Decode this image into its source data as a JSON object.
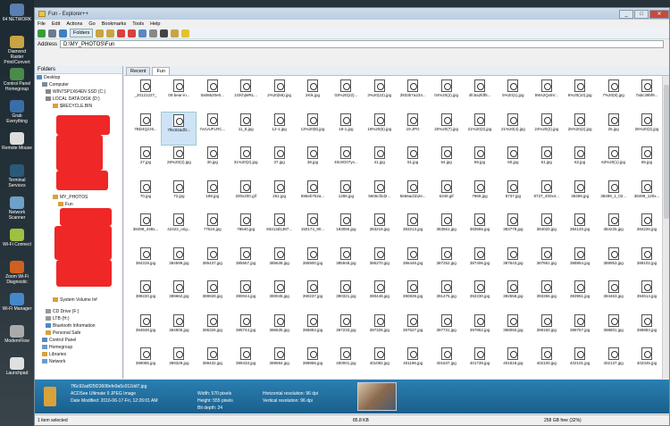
{
  "window": {
    "title": "Fun - Explorer++"
  },
  "menu": [
    "File",
    "Edit",
    "Actions",
    "Go",
    "Bookmarks",
    "Tools",
    "Help"
  ],
  "toolbar": {
    "folders_label": "Folders"
  },
  "address": {
    "label": "Address",
    "value": "D:\\MY_PHOTOS\\Fun"
  },
  "tabs": [
    "Recent",
    "Fun"
  ],
  "folders_pane": {
    "title": "Folders",
    "items": [
      "Desktop",
      "Computer",
      "WIN7SP1X64EN SSD (C:)",
      "LOCAL DATA DISK (D:)",
      "$RECYCLE.BIN",
      "MY_PHOTOS",
      "Fun",
      "System Volume Inf",
      "CD Drive (F:)",
      "LTB (H:)",
      "Bluetooth Information",
      "Personal Safe",
      "Control Panel",
      "Homegroup",
      "Libraries",
      "Network"
    ]
  },
  "files": [
    "_20121227_",
    "00-bear-in...",
    "0a08620e0...",
    "1GKhjMRL...",
    "2%20(66).jpg",
    "2Kik.jpg",
    "03%20(22)...",
    "3%20(22).jpg",
    "3933b7a234...",
    "04%20(2).jpg",
    "4fc5a2fdf5...",
    "5%20(1).jpg",
    "5Wx2Qx5V...",
    "6%20(10).jpg",
    "7%20(9).jpg",
    "7abc39bf9...",
    "7BD4Qzz6...",
    "7f6c92adf2...",
    "7vcUUFLRC...",
    "11_8.jpg",
    "12-1.jpg",
    "13%20(8).jpg",
    "18-1.jpg",
    "19%20(5).jpg",
    "19.JPG",
    "20%20(7).jpg",
    "21%20(3).jpg",
    "21%20(4).jpg",
    "24%20(2).jpg",
    "25%20(2).jpg",
    "25.jpg",
    "26%20(3).jpg",
    "27.jpg",
    "28%20(2).jpg",
    "30.jpg",
    "31%20(2).jpg",
    "37.jpg",
    "38.jpg",
    "40c8G07yx...",
    "41.jpg",
    "51.jpg",
    "54.jpg",
    "59.jpg",
    "60.jpg",
    "61.jpg",
    "62.jpg",
    "63%20(1).jpg",
    "65.jpg",
    "70.jpg",
    "72.jpg",
    "189.jpg",
    "200x200.gif",
    "261.jpg",
    "695eb762a...",
    "1286.jpg",
    "5606cf2d2...",
    "5666ad1b2e...",
    "6348.gif",
    "7869.jpg",
    "8737.jpg",
    "8737_400x4...",
    "38499.jpg",
    "38499_1_02...",
    "38499_120x...",
    "38499_448x...",
    "42422_orig...",
    "77524.jpg",
    "78540.jpg",
    "93413d1387...",
    "150174_90...",
    "183050.jpg",
    "383219.jpg",
    "383213.jpg",
    "383561.jpg",
    "383655.jpg",
    "383779.jpg",
    "384020.jpg",
    "384120.jpg",
    "384225.jpg",
    "384226.jpg",
    "384319.jpg",
    "384599.jpg",
    "385437.jpg",
    "385557.jpg",
    "385638.jpg",
    "385900.jpg",
    "385948.jpg",
    "386270.jpg",
    "386446.jpg",
    "387252.jpg",
    "387406.jpg",
    "387643.jpg",
    "387861.jpg",
    "388854.jpg",
    "388953.jpg",
    "389102.jpg",
    "389220.jpg",
    "389662.jpg",
    "389928.jpg",
    "390044.jpg",
    "390045.jpg",
    "390237.jpg",
    "390321.jpg",
    "390448.jpg",
    "390839.jpg",
    "391475.jpg",
    "392230.jpg",
    "392558.jpg",
    "393356.jpg",
    "393951.jpg",
    "394463.jpg",
    "394514.jpg",
    "394848.jpg",
    "394905.jpg",
    "395326.jpg",
    "395744.jpg",
    "396635.jpg",
    "396884.jpg",
    "397233.jpg",
    "397328.jpg",
    "397527.jpg",
    "397731.jpg",
    "397862.jpg",
    "398050.jpg",
    "398160.jpg",
    "398767.jpg",
    "398801.jpg",
    "398884.jpg",
    "399085.jpg",
    "399329.jpg",
    "399432.jpg",
    "399433.jpg",
    "399594.jpg",
    "399856.jpg",
    "400001.jpg",
    "401082.jpg",
    "401196.jpg",
    "401637.jpg",
    "401739.jpg",
    "401818.jpg",
    "402100.jpg",
    "402101.jpg",
    "402137.jpg",
    "402345.jpg"
  ],
  "selected_index": 17,
  "info": {
    "filename": "7f6c92adf25f23608efe9a5c012dd7.jpg",
    "type": "ACDSee Ultimate 9 JPEG Image",
    "modified": "Date Modified: 2016-06-17-Fri, 12:26:01 AM",
    "width": "Width: 570 pixels",
    "height": "Height: 555 pixels",
    "bitdepth": "Bit depth: 24",
    "hres": "Horizontal resolution: 96 dpi",
    "vres": "Vertical resolution: 96 dpi"
  },
  "status": {
    "selected": "1 item selected",
    "size": "85.8 KB",
    "free": "258 GB free (32%)"
  },
  "desktop_icons": [
    "64 NETWORK",
    "Diamond Raster Print/Convert",
    "Control Panel Homegroup",
    "Grab Everything",
    "Remote Mouse",
    "Terminal Services",
    "Network Scanner",
    "Wi-Fi Connect",
    "Zoom Wi-Fi Diagnostic",
    "Wi-Fi Manager",
    "ModernFlow",
    "Launchpad"
  ]
}
